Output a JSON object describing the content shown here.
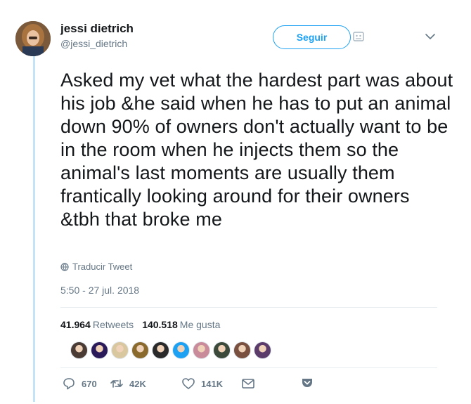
{
  "tweet": {
    "author": {
      "display_name": "jessi dietrich",
      "username": "@jessi_dietrich"
    },
    "follow_label": "Seguir",
    "text": "Asked my vet what the hardest part was about his job &he said when he has to put an animal down 90% of owners don't actually want to be in the room when he injects them so the animal's last moments are usually them frantically looking around for their owners &tbh that broke me",
    "translate_label": "Traducir Tweet",
    "timestamp": "5:50 - 27 jul. 2018",
    "stats": {
      "retweets_count": "41.964",
      "retweets_label": "Retweets",
      "likes_count": "140.518",
      "likes_label": "Me gusta"
    },
    "likers": [
      {
        "color": "#4a3b34"
      },
      {
        "color": "#2b1a5a"
      },
      {
        "color": "#d9c7a0"
      },
      {
        "color": "#8b6a2e"
      },
      {
        "color": "#2a2a2a"
      },
      {
        "color": "#1da1f2"
      },
      {
        "color": "#c98a9a"
      },
      {
        "color": "#3b4a3a"
      },
      {
        "color": "#7a5040"
      },
      {
        "color": "#5a3b6a"
      }
    ],
    "actions": {
      "replies": "670",
      "retweets": "42K",
      "likes": "141K"
    }
  },
  "colors": {
    "accent": "#1da1f2",
    "secondary_text": "#657786",
    "thread_line": "#c2e4f6"
  },
  "icons": [
    "translate-globe-icon",
    "reply-icon",
    "retweet-icon",
    "like-icon",
    "direct-message-icon",
    "chevron-down-icon",
    "pocket-save-icon",
    "block-icon"
  ]
}
